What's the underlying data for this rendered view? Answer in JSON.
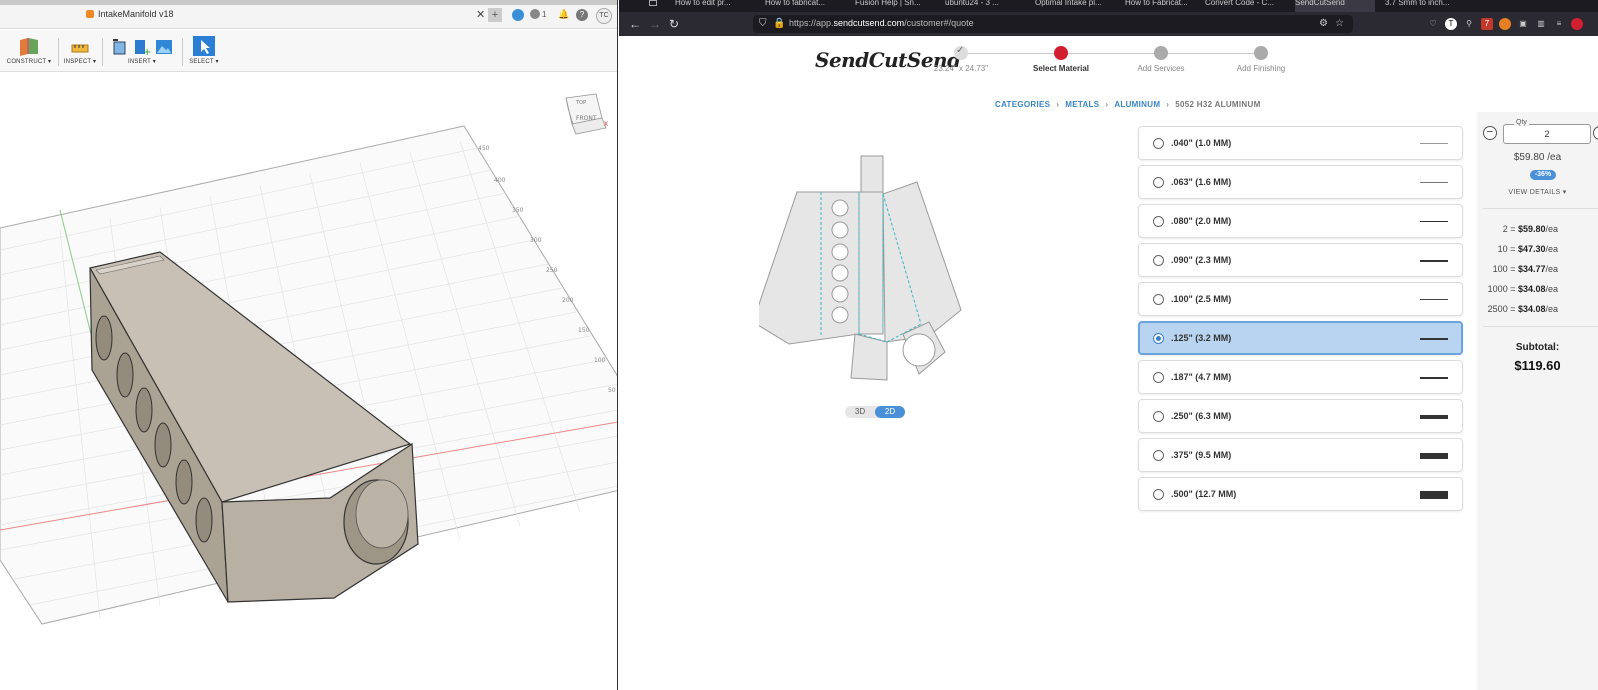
{
  "fusion": {
    "doc_title": "IntakeManifold v18",
    "user_initials": "TC",
    "notifications_count": "1",
    "toolbar": [
      {
        "label": "CONSTRUCT ▾"
      },
      {
        "label": "INSPECT ▾"
      },
      {
        "label": "INSERT ▾"
      },
      {
        "label": "SELECT ▾"
      }
    ],
    "viewcube": {
      "top": "TOP",
      "front": "FRONT",
      "axis": "X"
    },
    "grid_labels": [
      "450",
      "400",
      "350",
      "300",
      "250",
      "200",
      "150",
      "100",
      "50"
    ]
  },
  "browser": {
    "tabs": [
      "How to edit pr...",
      "How to fabricat...",
      "Fusion Help | Sn...",
      "ubuntu24 - 3 ...",
      "Optimal Intake pl...",
      "How to Fabricat...",
      "Convert Code - C...",
      "SendCutSend",
      "3.7 Smm to inch..."
    ],
    "url_prefix": "https://app.",
    "url_domain": "sendcutsend.com",
    "url_path": "/customer#/quote",
    "badge_count": "7"
  },
  "page": {
    "brand": "SendCutSend",
    "steps": [
      {
        "label": "23.24\" x 24.73\"",
        "state": "done"
      },
      {
        "label": "Select Material",
        "state": "active"
      },
      {
        "label": "Add Services",
        "state": "todo"
      },
      {
        "label": "Add Finishing",
        "state": "todo"
      }
    ],
    "breadcrumb": {
      "categories": "CATEGORIES",
      "metals": "METALS",
      "aluminum": "ALUMINUM",
      "current": "5052 H32 ALUMINUM"
    },
    "view_toggle": {
      "opt_3d": "3D",
      "opt_2d": "2D",
      "selected": "2D"
    },
    "materials": [
      {
        "label": ".040\" (1.0 MM)",
        "selected": false
      },
      {
        "label": ".063\" (1.6 MM)",
        "selected": false
      },
      {
        "label": ".080\" (2.0 MM)",
        "selected": false
      },
      {
        "label": ".090\" (2.3 MM)",
        "selected": false
      },
      {
        "label": ".100\" (2.5 MM)",
        "selected": false
      },
      {
        "label": ".125\" (3.2 MM)",
        "selected": true
      },
      {
        "label": ".187\" (4.7 MM)",
        "selected": false
      },
      {
        "label": ".250\" (6.3 MM)",
        "selected": false
      },
      {
        "label": ".375\" (9.5 MM)",
        "selected": false
      },
      {
        "label": ".500\" (12.7 MM)",
        "selected": false
      }
    ],
    "side": {
      "qty_label": "Qty",
      "qty_value": "2",
      "unit_price": "$59.80 /ea",
      "discount": "-36%",
      "view_details": "VIEW DETAILS ▾",
      "tiers": [
        {
          "qty": "2 = ",
          "price": "$59.80",
          "unit": "/ea"
        },
        {
          "qty": "10 = ",
          "price": "$47.30",
          "unit": "/ea"
        },
        {
          "qty": "100 = ",
          "price": "$34.77",
          "unit": "/ea"
        },
        {
          "qty": "1000 = ",
          "price": "$34.08",
          "unit": "/ea"
        },
        {
          "qty": "2500 = ",
          "price": "$34.08",
          "unit": "/ea"
        }
      ],
      "subtotal_label": "Subtotal:",
      "subtotal_value": "$119.60"
    }
  }
}
